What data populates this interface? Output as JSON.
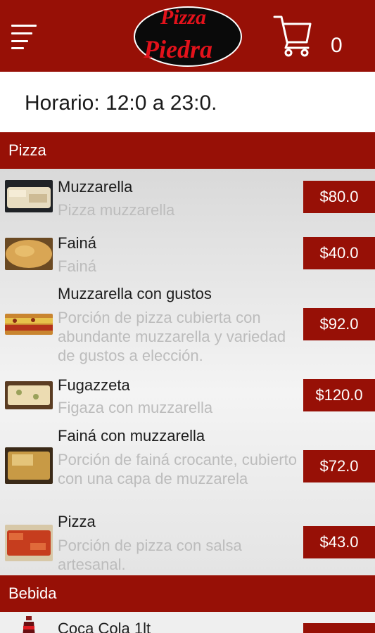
{
  "header": {
    "menu_icon": "hamburger-menu-icon",
    "logo_line1": "Pizza",
    "logo_line2": "Piedra",
    "cart_icon": "shopping-cart-icon",
    "cart_count": "0"
  },
  "hours": {
    "text": "Horario: 12:0 a 23:0."
  },
  "sections": [
    {
      "title": "Pizza",
      "items": [
        {
          "name": "Muzzarella",
          "description": "Pizza muzzarella",
          "price": "$80.0"
        },
        {
          "name": "Fainá",
          "description": "Fainá",
          "price": "$40.0"
        },
        {
          "name": "Muzzarella con gustos",
          "description": "Porción de pizza cubierta con abundante muzzarella y variedad de gustos a elección.",
          "price": "$92.0"
        },
        {
          "name": "Fugazzeta",
          "description": "Figaza con muzzarella",
          "price": "$120.0"
        },
        {
          "name": "Fainá con muzzarella",
          "description": "Porción de fainá crocante, cubierto con una capa de muzzarela",
          "price": "$72.0"
        },
        {
          "name": "Pizza",
          "description": "Porción de pizza con salsa artesanal.",
          "price": "$43.0"
        }
      ]
    },
    {
      "title": "Bebida",
      "items": [
        {
          "name": "Coca Cola 1lt"
        }
      ]
    }
  ],
  "colors": {
    "brand": "#971006",
    "price_bg": "#971006",
    "description": "#bcbcbc"
  }
}
